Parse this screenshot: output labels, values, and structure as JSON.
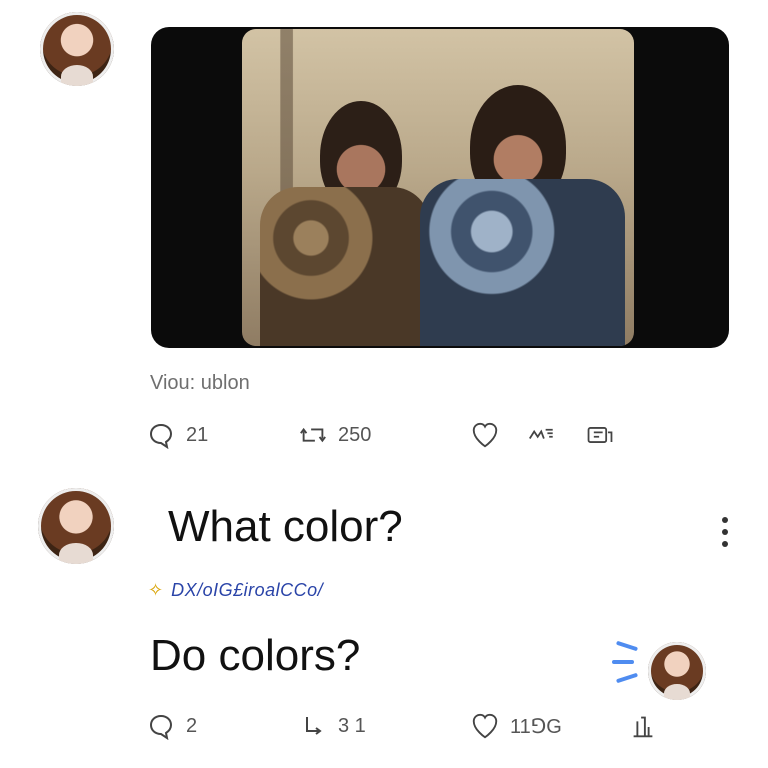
{
  "post": {
    "handle": "Viou: ublon",
    "image_alt": "vintage photo of two bearded men",
    "actions": {
      "reply": {
        "icon": "speech-bubble-icon",
        "count": "21"
      },
      "repost": {
        "icon": "repost-icon",
        "count": "250"
      },
      "like": {
        "icon": "heart-icon"
      },
      "views": {
        "icon": "views-icon"
      },
      "share": {
        "icon": "share-icon"
      }
    }
  },
  "comment": {
    "text": "What color?",
    "menu_icon": "more-vertical-icon"
  },
  "reply": {
    "garbled_handle": "DX/oIG£iroalCCo/",
    "text": "Do colors?",
    "actions": {
      "reply": {
        "icon": "speech-bubble-icon",
        "count": "2"
      },
      "repost": {
        "icon": "repost-icon",
        "count": "3 1"
      },
      "like": {
        "icon": "heart-icon",
        "count": "11⅁G"
      },
      "share": {
        "icon": "share-icon",
        "count": ""
      }
    }
  },
  "colors": {
    "background": "#ffffff",
    "media_frame": "#0b0b0b",
    "link_blue": "#2a44a8",
    "burst_blue": "#4f8cf0"
  }
}
